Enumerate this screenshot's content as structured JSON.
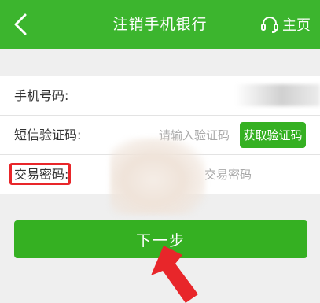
{
  "header": {
    "title": "注销手机银行",
    "home_label": "主页",
    "background_color": "#3cb52e"
  },
  "form": {
    "phone": {
      "label": "手机号码:"
    },
    "sms": {
      "label": "短信验证码:",
      "placeholder": "请输入验证码",
      "get_code_label": "获取验证码"
    },
    "password": {
      "label": "交易密码:",
      "placeholder": "交易密码"
    }
  },
  "actions": {
    "next_label": "下一步",
    "button_color": "#35b022"
  },
  "annotations": {
    "highlight_color": "#e8262a",
    "arrow_color": "#e8262a"
  }
}
